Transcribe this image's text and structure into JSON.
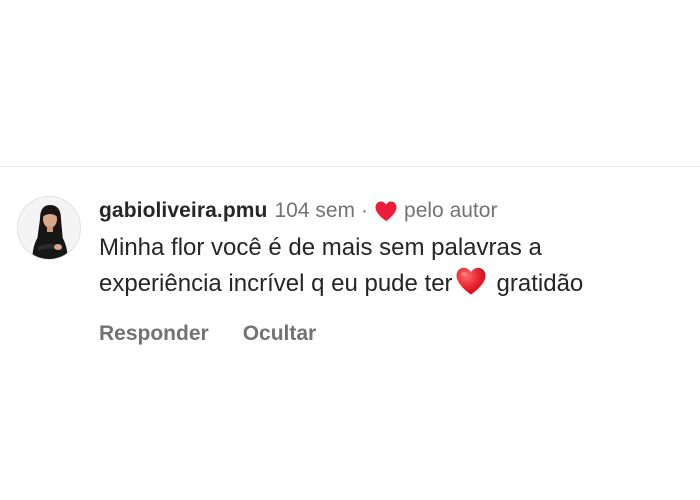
{
  "comment": {
    "username": "gabioliveira.pmu",
    "time": "104 sem",
    "separator": "·",
    "liked_by_author_icon": "heart-icon",
    "liked_by_author_label": "pelo autor",
    "text_line1": "Minha flor você é de mais sem palavras a",
    "text_line2_before_emoji": "experiência incrível q eu pude ter",
    "text_emoji": "red-heart-emoji",
    "text_line2_after_emoji": "gratidão",
    "avatar_icon": "profile-photo",
    "heart_color": "#ed1c3a"
  },
  "actions": {
    "reply_label": "Responder",
    "hide_label": "Ocultar"
  }
}
